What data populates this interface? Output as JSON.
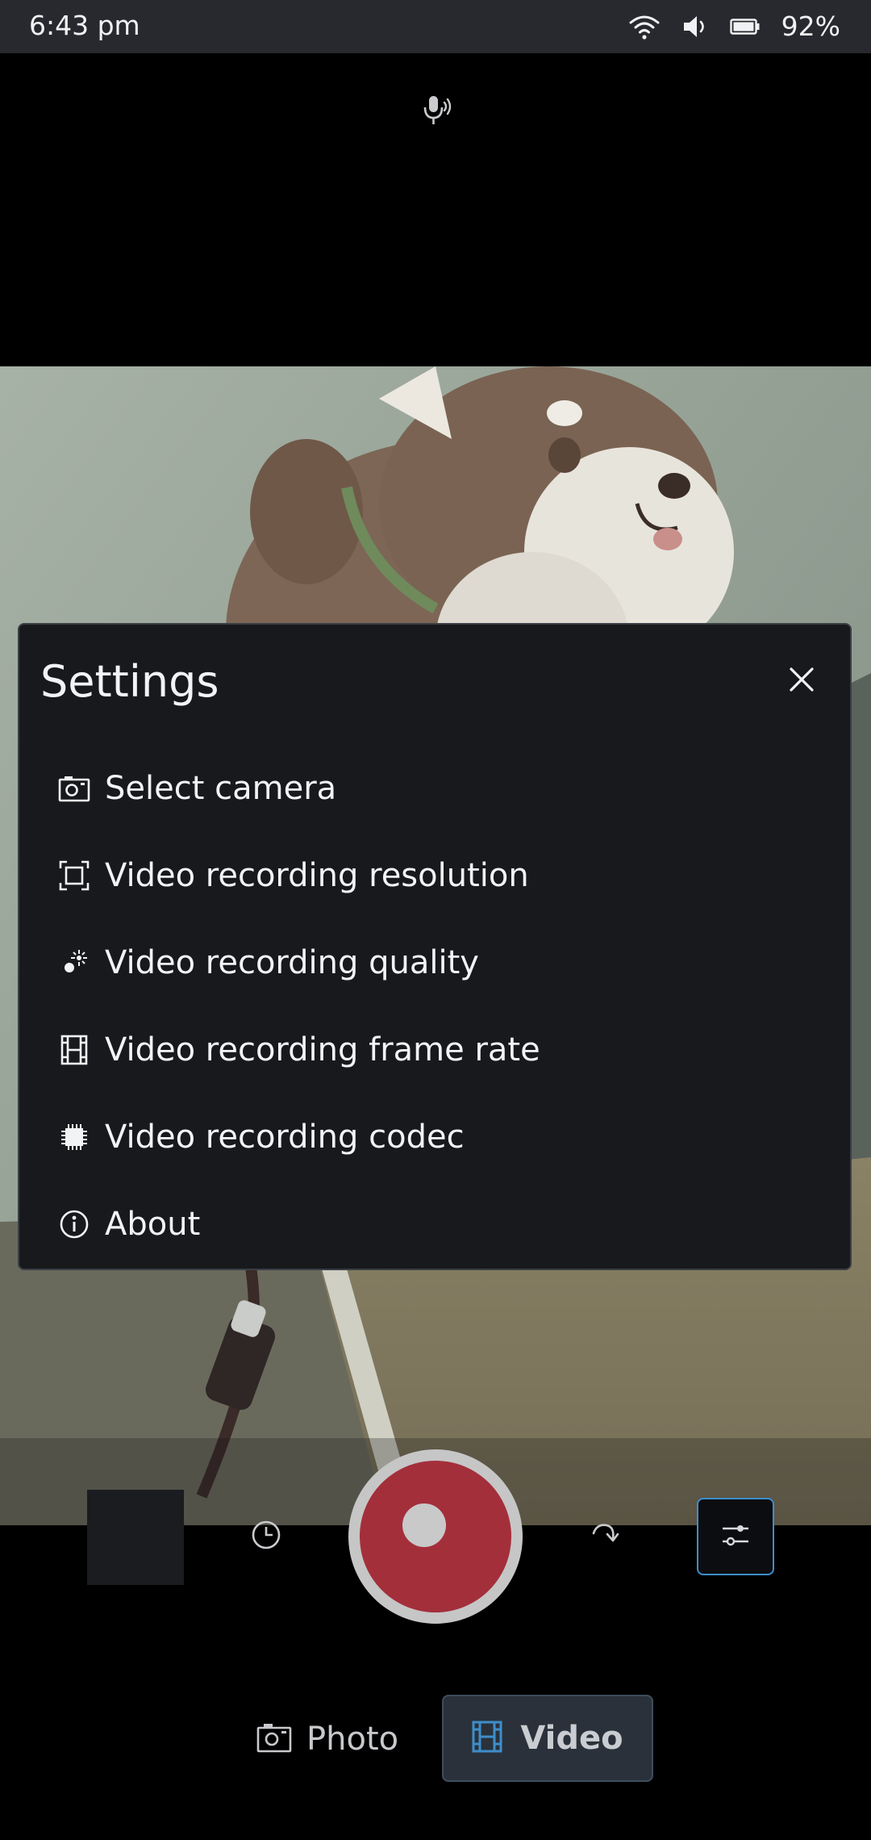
{
  "status_bar": {
    "time": "6:43 pm",
    "battery_percent": "92%",
    "icons": [
      "wifi-icon",
      "volume-icon",
      "battery-icon"
    ]
  },
  "recording_indicator": {
    "icon": "microphone-icon"
  },
  "settings_dialog": {
    "title": "Settings",
    "close_icon": "close-icon",
    "items": [
      {
        "label": "Select camera",
        "icon": "camera-icon"
      },
      {
        "label": "Video recording resolution",
        "icon": "resolution-icon"
      },
      {
        "label": "Video recording quality",
        "icon": "quality-icon"
      },
      {
        "label": "Video recording frame rate",
        "icon": "film-icon"
      },
      {
        "label": "Video recording codec",
        "icon": "chip-icon"
      },
      {
        "label": "About",
        "icon": "info-icon"
      }
    ]
  },
  "controls": {
    "gallery_thumbnail": "gallery-thumbnail",
    "timer_icon": "timer-icon",
    "record_icon": "record-icon",
    "switch_camera_icon": "switch-camera-icon",
    "settings_icon": "settings-sliders-icon"
  },
  "modes": {
    "photo_label": "Photo",
    "video_label": "Video",
    "selected": "Video"
  },
  "colors": {
    "accent": "#3d8ecb",
    "record": "#a32f3b",
    "dialog_bg": "#18191c",
    "status_bar_bg": "#27292e"
  }
}
